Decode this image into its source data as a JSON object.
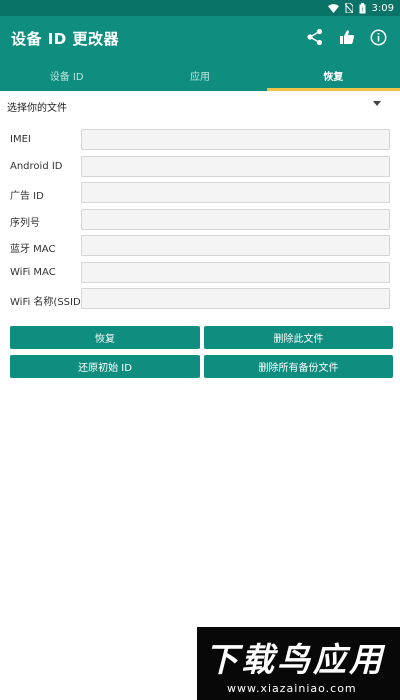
{
  "status_bar": {
    "time": "3:09",
    "icons": [
      "wifi-icon",
      "no-sim-icon",
      "battery-icon"
    ]
  },
  "app_bar": {
    "title": "设备 ID 更改器",
    "actions": [
      "share-icon",
      "thumbs-up-icon",
      "info-icon"
    ]
  },
  "tabs": [
    {
      "label": "设备 ID",
      "active": false
    },
    {
      "label": "应用",
      "active": false
    },
    {
      "label": "恢复",
      "active": true
    }
  ],
  "file_picker": {
    "label": "选择你的文件"
  },
  "fields": [
    {
      "label": "IMEI",
      "value": ""
    },
    {
      "label": "Android ID",
      "value": ""
    },
    {
      "label": "广告 ID",
      "value": ""
    },
    {
      "label": "序列号",
      "value": ""
    },
    {
      "label": "蓝牙 MAC",
      "value": ""
    },
    {
      "label": "WiFi MAC",
      "value": ""
    },
    {
      "label": "WiFi 名称(SSID)",
      "value": ""
    }
  ],
  "buttons": {
    "restore": "恢复",
    "delete_file": "删除此文件",
    "restore_original": "还原初始 ID",
    "delete_all": "删除所有备份文件"
  },
  "watermark": {
    "title": "下载鸟应用",
    "url": "www.xiazainiao.com"
  },
  "colors": {
    "primary": "#0f8d7f",
    "status_bar": "#0a7367",
    "tab_indicator": "#f0c24a"
  }
}
